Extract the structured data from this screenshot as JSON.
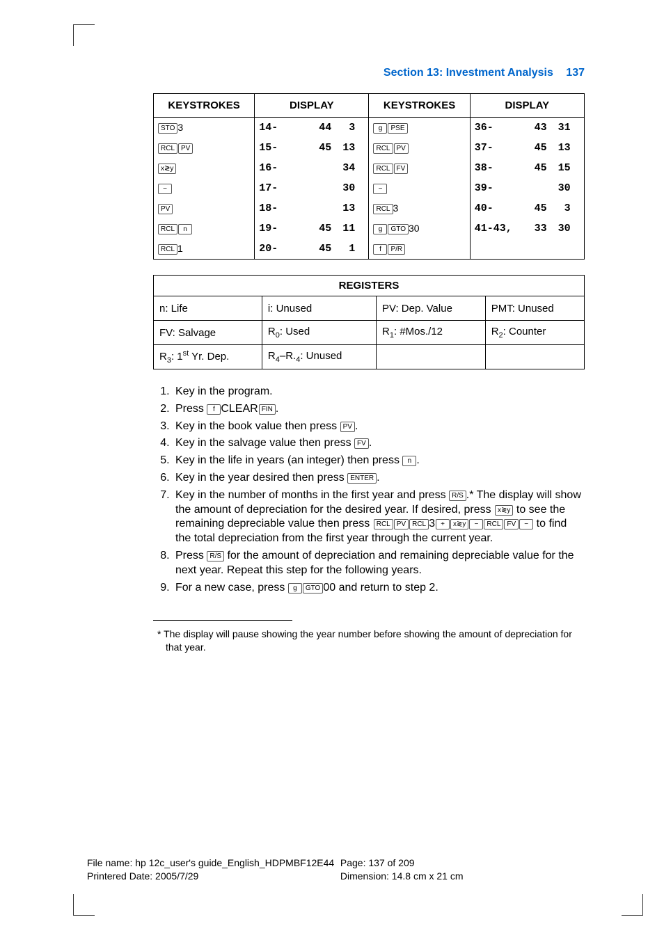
{
  "header": {
    "section": "Section 13: Investment Analysis",
    "page_no": "137"
  },
  "keytable": {
    "headers": [
      "KEYSTROKES",
      "DISPLAY",
      "KEYSTROKES",
      "DISPLAY"
    ],
    "rows": [
      {
        "k1": [
          [
            "STO"
          ],
          "3"
        ],
        "d1": [
          "14-",
          "44",
          "3"
        ],
        "k2": [
          [
            "g"
          ],
          [
            "PSE"
          ]
        ],
        "d2": [
          "36-",
          "43",
          "31"
        ]
      },
      {
        "k1": [
          [
            "RCL"
          ],
          [
            "PV"
          ]
        ],
        "d1": [
          "15-",
          "45",
          "13"
        ],
        "k2": [
          [
            "RCL"
          ],
          [
            "PV"
          ]
        ],
        "d2": [
          "37-",
          "45",
          "13"
        ]
      },
      {
        "k1": [
          [
            "x≷y"
          ]
        ],
        "d1": [
          "16-",
          "",
          "34"
        ],
        "k2": [
          [
            "RCL"
          ],
          [
            "FV"
          ]
        ],
        "d2": [
          "38-",
          "45",
          "15"
        ]
      },
      {
        "k1": [
          [
            "−"
          ]
        ],
        "d1": [
          "17-",
          "",
          "30"
        ],
        "k2": [
          [
            "−"
          ]
        ],
        "d2": [
          "39-",
          "",
          "30"
        ]
      },
      {
        "k1": [
          [
            "PV"
          ]
        ],
        "d1": [
          "18-",
          "",
          "13"
        ],
        "k2": [
          [
            "RCL"
          ],
          "3"
        ],
        "d2": [
          "40-",
          "45",
          "3"
        ]
      },
      {
        "k1": [
          [
            "RCL"
          ],
          [
            "n"
          ]
        ],
        "d1": [
          "19-",
          "45",
          "11"
        ],
        "k2": [
          [
            "g"
          ],
          [
            "GTO"
          ],
          "30"
        ],
        "d2": [
          "41-43,",
          "33",
          "30"
        ]
      },
      {
        "k1": [
          [
            "RCL"
          ],
          "1"
        ],
        "d1": [
          "20-",
          "45",
          "1"
        ],
        "k2": [
          [
            "f"
          ],
          [
            "P/R"
          ]
        ],
        "d2": [
          "",
          "",
          ""
        ]
      }
    ]
  },
  "registers": {
    "title": "REGISTERS",
    "grid": [
      [
        "n: Life",
        "i: Unused",
        "PV: Dep. Value",
        "PMT: Unused"
      ],
      [
        "FV: Salvage",
        "R₀: Used",
        "R₁: #Mos./12",
        "R₂: Counter"
      ],
      [
        "R₃: 1ˢᵗ Yr. Dep.",
        "R₄–R.₄: Unused",
        "",
        ""
      ]
    ]
  },
  "steps": {
    "items": [
      "Key in the program.",
      "Press [f]CLEAR[FIN].",
      "Key in the book value then press [PV].",
      "Key in the salvage value then press [FV].",
      "Key in the life in years (an integer) then press [n].",
      "Key in the year desired then press [ENTER].",
      "Key in the number of months in the first year and press [R/S].*  The display will show the amount of depreciation for the desired year. If desired, press [x≷y] to see the remaining depreciable value then press [RCL][PV][RCL]3[+][x≷y][−][RCL][FV][−] to find the total depreciation from the first year through the current year.",
      "Press [R/S] for the amount of depreciation and remaining depreciable value for the next year. Repeat this step for the following years.",
      "For a new case, press [g][GTO]00 and return to step 2."
    ]
  },
  "footnote": "*  The display will pause showing the year number before showing the amount of depreciation for that year.",
  "footer": {
    "filename": "File name: hp 12c_user's guide_English_HDPMBF12E44",
    "printered": "Printered Date: 2005/7/29",
    "page": "Page: 137 of 209",
    "dim": "Dimension: 14.8 cm x 21 cm"
  }
}
